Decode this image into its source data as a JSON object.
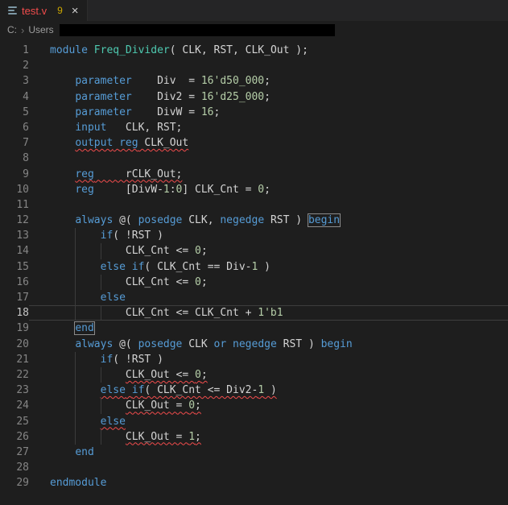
{
  "tab": {
    "filename": "test.v",
    "problem_count": "9",
    "close_glyph": "×"
  },
  "breadcrumb": {
    "drive": "C:",
    "separator": "›",
    "folder": "Users"
  },
  "colors": {
    "background": "#1e1e1e",
    "tabbar_background": "#252526",
    "error_red": "#f14c4c",
    "problem_badge": "#cca700",
    "keyword_blue": "#569cd6",
    "module_name_teal": "#4ec9b0",
    "number_green": "#b5cea8",
    "plain_text": "#d4d4d4",
    "line_number": "#858585"
  },
  "editor": {
    "lines": [
      {
        "n": "1",
        "indent": 0,
        "tokens": [
          {
            "t": "module",
            "c": "kw"
          },
          {
            "t": " ",
            "c": "pl"
          },
          {
            "t": "Freq_Divider",
            "c": "name"
          },
          {
            "t": "( CLK, RST, CLK_Out );",
            "c": "pl"
          }
        ]
      },
      {
        "n": "2",
        "indent": 0,
        "tokens": []
      },
      {
        "n": "3",
        "indent": 4,
        "tokens": [
          {
            "t": "    ",
            "c": "pl"
          },
          {
            "t": "parameter",
            "c": "kw"
          },
          {
            "t": "    Div  = ",
            "c": "pl"
          },
          {
            "t": "16'd50_000",
            "c": "num"
          },
          {
            "t": ";",
            "c": "pl"
          }
        ]
      },
      {
        "n": "4",
        "indent": 4,
        "tokens": [
          {
            "t": "    ",
            "c": "pl"
          },
          {
            "t": "parameter",
            "c": "kw"
          },
          {
            "t": "    Div2 = ",
            "c": "pl"
          },
          {
            "t": "16'd25_000",
            "c": "num"
          },
          {
            "t": ";",
            "c": "pl"
          }
        ]
      },
      {
        "n": "5",
        "indent": 4,
        "tokens": [
          {
            "t": "    ",
            "c": "pl"
          },
          {
            "t": "parameter",
            "c": "kw"
          },
          {
            "t": "    DivW = ",
            "c": "pl"
          },
          {
            "t": "16",
            "c": "num"
          },
          {
            "t": ";",
            "c": "pl"
          }
        ]
      },
      {
        "n": "6",
        "indent": 4,
        "tokens": [
          {
            "t": "    ",
            "c": "pl"
          },
          {
            "t": "input",
            "c": "kw"
          },
          {
            "t": "   CLK, RST;",
            "c": "pl"
          }
        ]
      },
      {
        "n": "7",
        "indent": 4,
        "tokens": [
          {
            "t": "    ",
            "c": "pl"
          },
          {
            "t": "output",
            "c": "kw",
            "q": true
          },
          {
            "t": " ",
            "c": "pl",
            "q": true
          },
          {
            "t": "reg",
            "c": "kw",
            "q": true
          },
          {
            "t": " CLK_Out",
            "c": "pl",
            "q": true
          }
        ]
      },
      {
        "n": "8",
        "indent": 0,
        "tokens": []
      },
      {
        "n": "9",
        "indent": 4,
        "tokens": [
          {
            "t": "    ",
            "c": "pl"
          },
          {
            "t": "reg",
            "c": "kw",
            "q": true
          },
          {
            "t": "     rCLK_Out;",
            "c": "pl",
            "q": true
          }
        ]
      },
      {
        "n": "10",
        "indent": 4,
        "tokens": [
          {
            "t": "    ",
            "c": "pl"
          },
          {
            "t": "reg",
            "c": "kw"
          },
          {
            "t": "     [DivW-",
            "c": "pl"
          },
          {
            "t": "1",
            "c": "num"
          },
          {
            "t": ":",
            "c": "pl"
          },
          {
            "t": "0",
            "c": "num"
          },
          {
            "t": "] CLK_Cnt = ",
            "c": "pl"
          },
          {
            "t": "0",
            "c": "num"
          },
          {
            "t": ";",
            "c": "pl"
          }
        ]
      },
      {
        "n": "11",
        "indent": 0,
        "tokens": []
      },
      {
        "n": "12",
        "indent": 4,
        "tokens": [
          {
            "t": "    ",
            "c": "pl"
          },
          {
            "t": "always",
            "c": "kw"
          },
          {
            "t": " @( ",
            "c": "pl"
          },
          {
            "t": "posedge",
            "c": "kw"
          },
          {
            "t": " CLK, ",
            "c": "pl"
          },
          {
            "t": "negedge",
            "c": "kw"
          },
          {
            "t": " RST ) ",
            "c": "pl"
          },
          {
            "t": "begin",
            "c": "kw",
            "b": true
          }
        ]
      },
      {
        "n": "13",
        "indent": 8,
        "tokens": [
          {
            "t": "        ",
            "c": "pl"
          },
          {
            "t": "if",
            "c": "kw"
          },
          {
            "t": "( !RST )",
            "c": "pl"
          }
        ]
      },
      {
        "n": "14",
        "indent": 12,
        "tokens": [
          {
            "t": "            CLK_Cnt <= ",
            "c": "pl"
          },
          {
            "t": "0",
            "c": "num"
          },
          {
            "t": ";",
            "c": "pl"
          }
        ]
      },
      {
        "n": "15",
        "indent": 8,
        "tokens": [
          {
            "t": "        ",
            "c": "pl"
          },
          {
            "t": "else",
            "c": "kw"
          },
          {
            "t": " ",
            "c": "pl"
          },
          {
            "t": "if",
            "c": "kw"
          },
          {
            "t": "( CLK_Cnt == Div-",
            "c": "pl"
          },
          {
            "t": "1",
            "c": "num"
          },
          {
            "t": " )",
            "c": "pl"
          }
        ]
      },
      {
        "n": "16",
        "indent": 12,
        "tokens": [
          {
            "t": "            CLK_Cnt <= ",
            "c": "pl"
          },
          {
            "t": "0",
            "c": "num"
          },
          {
            "t": ";",
            "c": "pl"
          }
        ]
      },
      {
        "n": "17",
        "indent": 8,
        "tokens": [
          {
            "t": "        ",
            "c": "pl"
          },
          {
            "t": "else",
            "c": "kw"
          }
        ]
      },
      {
        "n": "18",
        "indent": 12,
        "cur": true,
        "tokens": [
          {
            "t": "            CLK_Cnt <= CLK_Cnt + ",
            "c": "pl"
          },
          {
            "t": "1'b1",
            "c": "num"
          }
        ]
      },
      {
        "n": "19",
        "indent": 4,
        "tokens": [
          {
            "t": "    ",
            "c": "pl"
          },
          {
            "t": "end",
            "c": "kw",
            "b": true
          }
        ]
      },
      {
        "n": "20",
        "indent": 4,
        "tokens": [
          {
            "t": "    ",
            "c": "pl"
          },
          {
            "t": "always",
            "c": "kw"
          },
          {
            "t": " @( ",
            "c": "pl"
          },
          {
            "t": "posedge",
            "c": "kw"
          },
          {
            "t": " CLK ",
            "c": "pl"
          },
          {
            "t": "or",
            "c": "kw"
          },
          {
            "t": " ",
            "c": "pl"
          },
          {
            "t": "negedge",
            "c": "kw"
          },
          {
            "t": " RST ) ",
            "c": "pl"
          },
          {
            "t": "begin",
            "c": "kw"
          }
        ]
      },
      {
        "n": "21",
        "indent": 8,
        "tokens": [
          {
            "t": "        ",
            "c": "pl"
          },
          {
            "t": "if",
            "c": "kw"
          },
          {
            "t": "( !RST )",
            "c": "pl"
          }
        ]
      },
      {
        "n": "22",
        "indent": 12,
        "tokens": [
          {
            "t": "            ",
            "c": "pl"
          },
          {
            "t": "CLK_Out <= ",
            "c": "pl",
            "q": true
          },
          {
            "t": "0",
            "c": "num",
            "q": true
          },
          {
            "t": ";",
            "c": "pl",
            "q": true
          }
        ]
      },
      {
        "n": "23",
        "indent": 8,
        "tokens": [
          {
            "t": "        ",
            "c": "pl"
          },
          {
            "t": "else",
            "c": "kw",
            "q": true
          },
          {
            "t": " ",
            "c": "pl",
            "q": true
          },
          {
            "t": "if",
            "c": "kw",
            "q": true
          },
          {
            "t": "( CLK_Cnt <= Div2-",
            "c": "pl",
            "q": true
          },
          {
            "t": "1",
            "c": "num",
            "q": true
          },
          {
            "t": " )",
            "c": "pl",
            "q": true
          }
        ]
      },
      {
        "n": "24",
        "indent": 12,
        "tokens": [
          {
            "t": "            ",
            "c": "pl"
          },
          {
            "t": "CLK_Out = ",
            "c": "pl",
            "q": true
          },
          {
            "t": "0",
            "c": "num",
            "q": true
          },
          {
            "t": ";",
            "c": "pl",
            "q": true
          }
        ]
      },
      {
        "n": "25",
        "indent": 8,
        "tokens": [
          {
            "t": "        ",
            "c": "pl"
          },
          {
            "t": "else",
            "c": "kw",
            "q": true
          }
        ]
      },
      {
        "n": "26",
        "indent": 12,
        "tokens": [
          {
            "t": "            ",
            "c": "pl"
          },
          {
            "t": "CLK_Out = ",
            "c": "pl",
            "q": true
          },
          {
            "t": "1",
            "c": "num",
            "q": true
          },
          {
            "t": ";",
            "c": "pl",
            "q": true
          }
        ]
      },
      {
        "n": "27",
        "indent": 4,
        "tokens": [
          {
            "t": "    ",
            "c": "pl"
          },
          {
            "t": "end",
            "c": "kw"
          }
        ]
      },
      {
        "n": "28",
        "indent": 0,
        "tokens": []
      },
      {
        "n": "29",
        "indent": 0,
        "tokens": [
          {
            "t": "endmodule",
            "c": "kw"
          }
        ]
      }
    ]
  }
}
